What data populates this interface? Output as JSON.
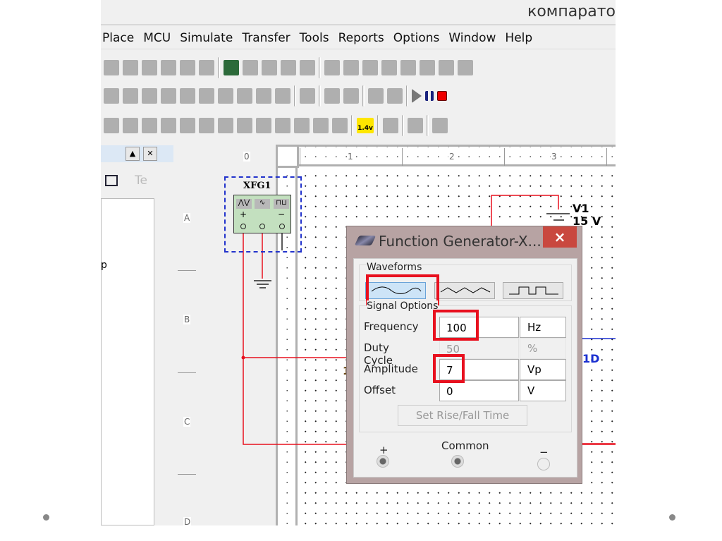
{
  "window": {
    "title_fragment": "компарато"
  },
  "menu": [
    "Place",
    "MCU",
    "Simulate",
    "Transfer",
    "Tools",
    "Reports",
    "Options",
    "Window",
    "Help"
  ],
  "toolbars": {
    "row1": [
      "print-preview-icon",
      "cut-icon",
      "copy-icon",
      "paste-icon",
      "undo-icon",
      "redo-icon",
      "sep",
      "full-screen-icon",
      "zoom-in-icon",
      "zoom-out-icon",
      "zoom-area-icon",
      "zoom-fit-icon",
      "sep",
      "design-toolbox-icon",
      "spreadsheet-icon",
      "database-icon",
      "breadboard-icon",
      "component-wizard-icon",
      "grapher-icon",
      "postprocessor-icon",
      "electrical-rules-icon"
    ],
    "row2": [
      "ttl-icon",
      "cmos-icon",
      "misc-digital-icon",
      "mixed-icon",
      "indicator-icon",
      "power-component-icon",
      "misc-icon",
      "advanced-peripherals-icon",
      "rf-icon",
      "electromechanical-icon",
      "sep",
      "mcu-icon",
      "sep",
      "hierarchical-block-icon",
      "bus-icon",
      "sep",
      "list-icon",
      "list2-icon",
      "sep",
      "run-icon",
      "pause-icon",
      "stop-icon"
    ],
    "row3": [
      "multimeter-icon",
      "function-generator-icon",
      "wattmeter-icon",
      "oscilloscope-icon",
      "four-channel-oscilloscope-icon",
      "bode-plotter-icon",
      "frequency-counter-icon",
      "word-generator-icon",
      "logic-analyzer-icon",
      "logic-converter-icon",
      "iv-analyzer-icon",
      "distortion-analyzer-icon",
      "spectrum-analyzer-icon",
      "sep",
      "probe-icon",
      "sep",
      "ni-instrument-icon",
      "sep",
      "labview-icon",
      "sep",
      "current-probe-icon"
    ],
    "probe_label": "1.4v"
  },
  "left_panel": {
    "text_icon_label": "Te",
    "partial_text": "p"
  },
  "rulers": {
    "columns": [
      "0",
      "1",
      "2",
      "3"
    ],
    "rows": [
      "A",
      "B",
      "C",
      "D"
    ]
  },
  "schematic": {
    "instrument": {
      "refdes": "XFG1",
      "plus": "+",
      "minus": "−"
    },
    "source": {
      "name": "V1",
      "value": "15 V"
    },
    "labels": {
      "blue": "1D",
      "brown": "1"
    },
    "wire_color": "#e8101e",
    "net_color": "#1a2fd0"
  },
  "dialog": {
    "title": "Function Generator-X...",
    "close": "×",
    "waveforms_label": "Waveforms",
    "waveforms": [
      {
        "name": "sine",
        "selected": true
      },
      {
        "name": "triangle",
        "selected": false
      },
      {
        "name": "square",
        "selected": false
      }
    ],
    "signal_options_label": "Signal Options",
    "fields": [
      {
        "label": "Frequency",
        "value": "100",
        "unit": "Hz",
        "enabled": true
      },
      {
        "label": "Duty Cycle",
        "value": "50",
        "unit": "%",
        "enabled": false
      },
      {
        "label": "Amplitude",
        "value": "7",
        "unit": "Vp",
        "enabled": true
      },
      {
        "label": "Offset",
        "value": "0",
        "unit": "V",
        "enabled": true
      }
    ],
    "rise_fall_button": "Set Rise/Fall Time",
    "terminals": {
      "plus": "+",
      "common": "Common",
      "minus": "−"
    },
    "highlight_color": "#e8101e"
  }
}
